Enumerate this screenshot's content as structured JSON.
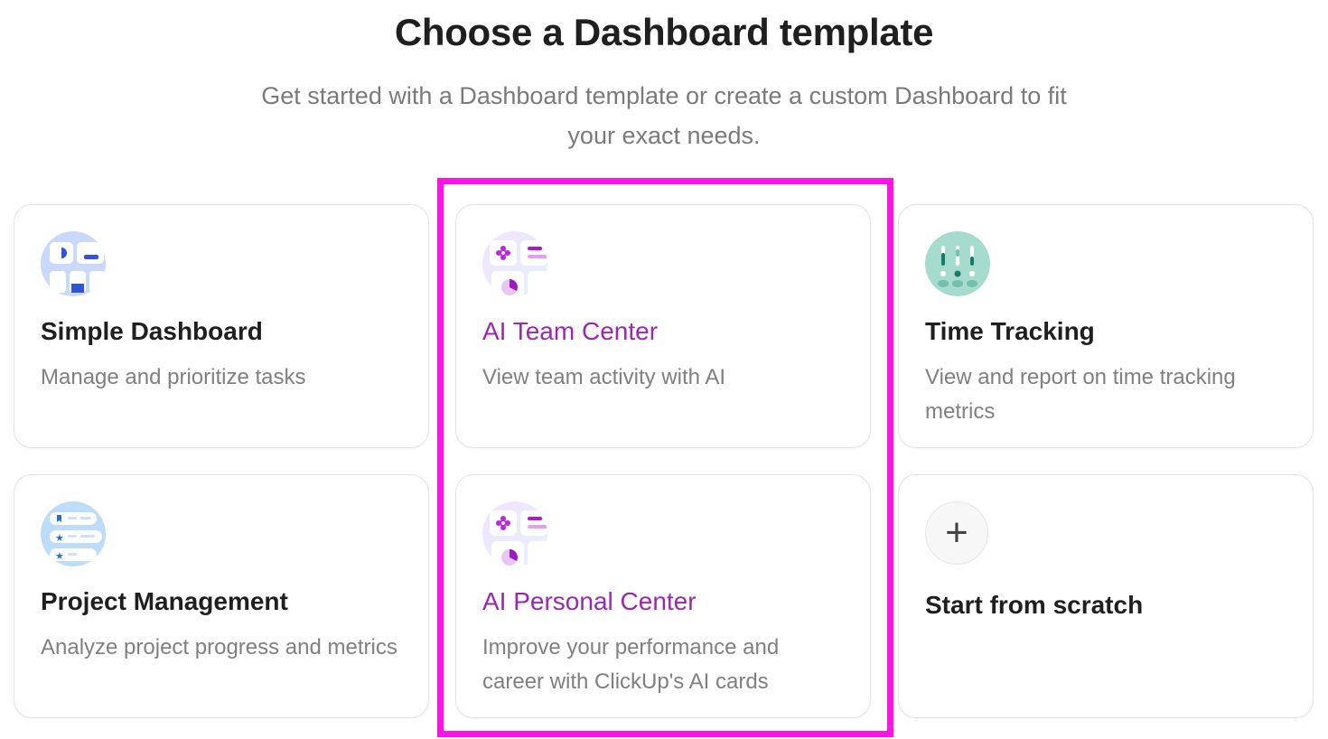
{
  "header": {
    "title": "Choose a Dashboard template",
    "subtitle": "Get started with a Dashboard template or create a custom Dashboard to fit your exact needs."
  },
  "templates": [
    {
      "title": "Simple Dashboard",
      "description": "Manage and prioritize tasks",
      "icon": "simple-dashboard-icon"
    },
    {
      "title": "AI Team Center",
      "description": "View team activity with AI",
      "icon": "ai-team-center-icon"
    },
    {
      "title": "Time Tracking",
      "description": "View and report on time tracking metrics",
      "icon": "time-tracking-icon"
    },
    {
      "title": "Project Management",
      "description": "Analyze project progress and metrics",
      "icon": "project-management-icon"
    },
    {
      "title": "AI Personal Center",
      "description": "Improve your performance and career with ClickUp's AI cards",
      "icon": "ai-personal-center-icon"
    },
    {
      "title": "Start from scratch",
      "icon": "plus-icon",
      "icon_glyph": "+"
    }
  ],
  "colors": {
    "ai_title": "#9c27b0",
    "highlight_border": "#ff12e8"
  }
}
